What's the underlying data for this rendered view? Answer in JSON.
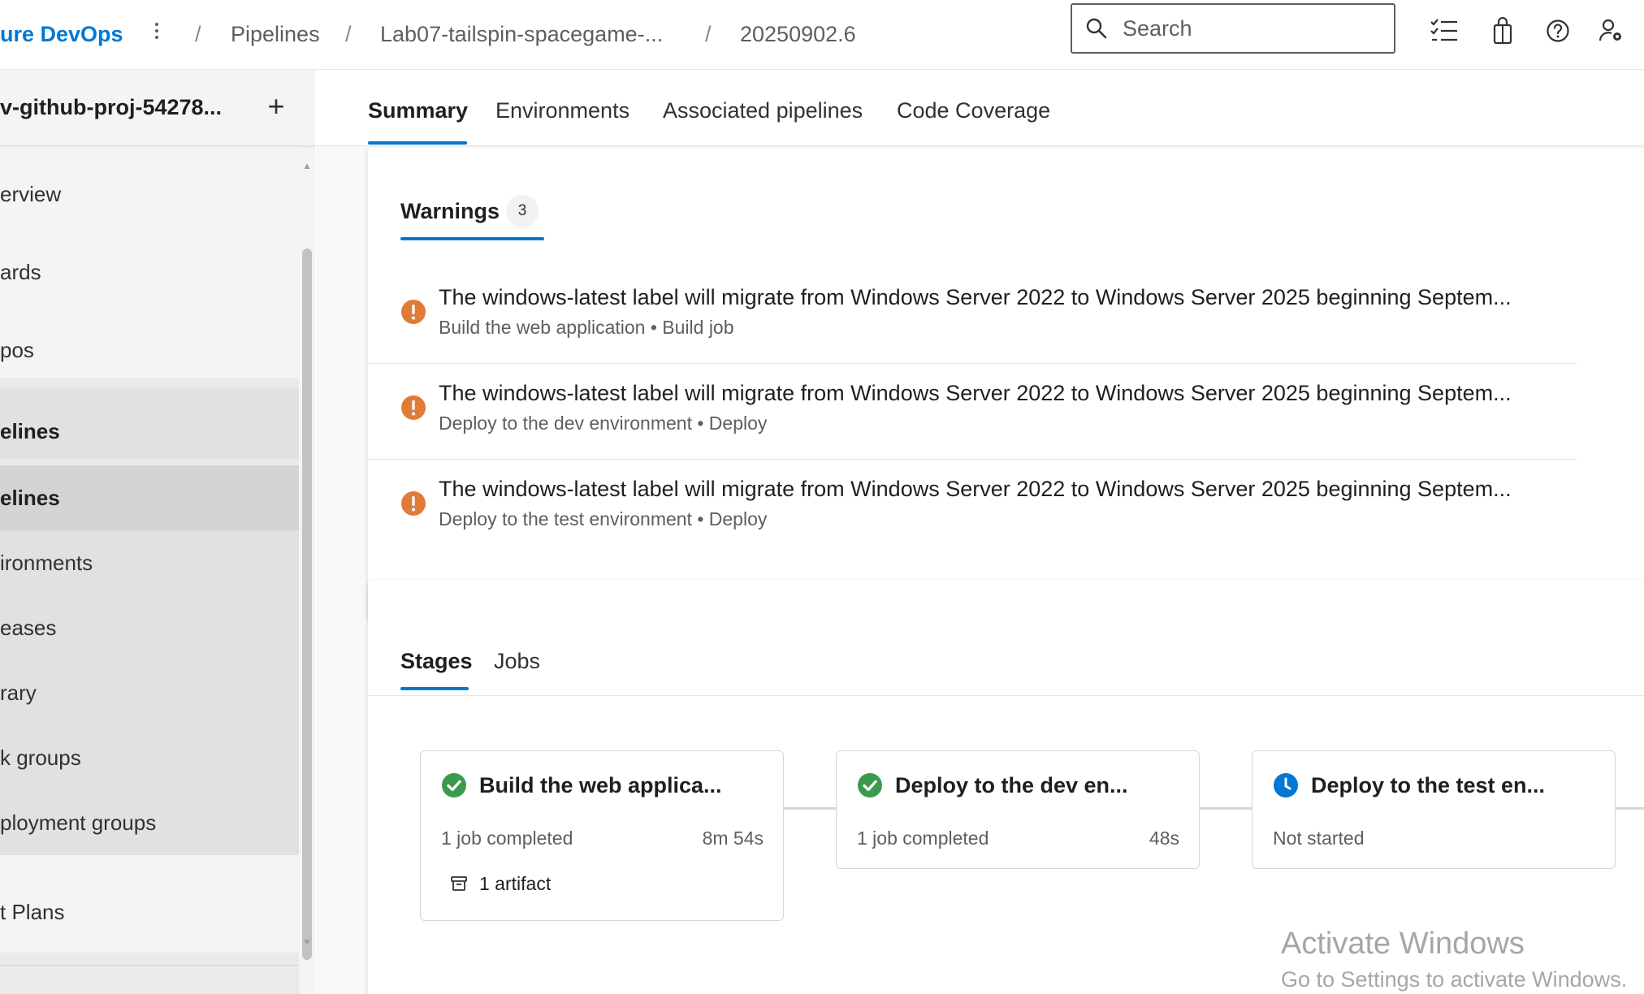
{
  "header": {
    "brand": "ure DevOps",
    "breadcrumbs": [
      "Pipelines",
      "Lab07-tailspin-spacegame-...",
      "20250902.6"
    ],
    "search_placeholder": "Search"
  },
  "sidebar": {
    "project_name": "v-github-proj-54278...",
    "items": [
      {
        "label": "erview"
      },
      {
        "label": "ards"
      },
      {
        "label": "pos"
      },
      {
        "label": "elines"
      },
      {
        "label": "elines"
      },
      {
        "label": "ironments"
      },
      {
        "label": "eases"
      },
      {
        "label": "rary"
      },
      {
        "label": "k groups"
      },
      {
        "label": "ployment groups"
      },
      {
        "label": "t Plans"
      }
    ]
  },
  "tabs": [
    "Summary",
    "Environments",
    "Associated pipelines",
    "Code Coverage"
  ],
  "warnings": {
    "tab_label": "Warnings",
    "count": "3",
    "items": [
      {
        "message": "The windows-latest label will migrate from Windows Server 2022 to Windows Server 2025 beginning Septem...",
        "source": "Build the web application • Build job"
      },
      {
        "message": "The windows-latest label will migrate from Windows Server 2022 to Windows Server 2025 beginning Septem...",
        "source": "Deploy to the dev environment • Deploy"
      },
      {
        "message": "The windows-latest label will migrate from Windows Server 2022 to Windows Server 2025 beginning Septem...",
        "source": "Deploy to the test environment • Deploy"
      }
    ]
  },
  "stages_section": {
    "tabs": [
      "Stages",
      "Jobs"
    ],
    "stages": [
      {
        "title": "Build the web applica...",
        "status": "succeeded",
        "meta": "1 job completed",
        "duration": "8m 54s",
        "artifact": "1 artifact"
      },
      {
        "title": "Deploy to the dev en...",
        "status": "succeeded",
        "meta": "1 job completed",
        "duration": "48s"
      },
      {
        "title": "Deploy to the test en...",
        "status": "pending",
        "meta": "Not started",
        "duration": ""
      }
    ]
  },
  "watermark": {
    "title": "Activate Windows",
    "subtitle": "Go to Settings to activate Windows."
  },
  "colors": {
    "accent": "#0078d4",
    "warning": "#e07b39",
    "success": "#3a9b4f",
    "pending": "#0078d4"
  }
}
